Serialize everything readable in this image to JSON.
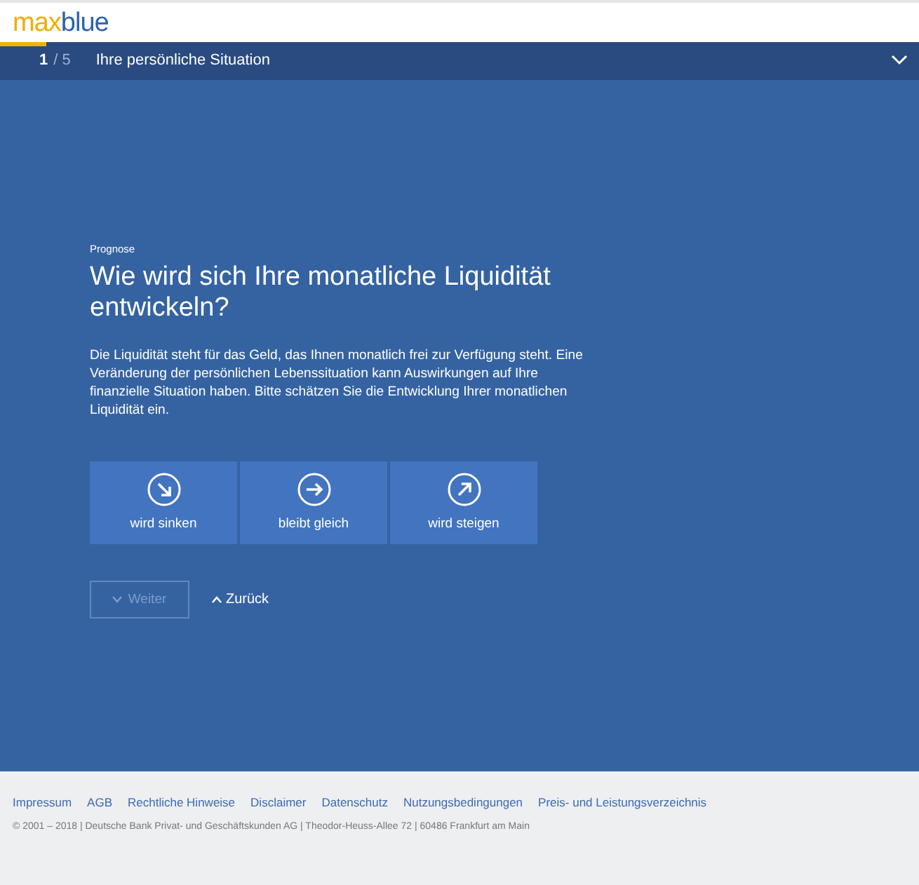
{
  "logo": {
    "part_1": "max",
    "part_2": "blue"
  },
  "steps": {
    "current": "1",
    "total": "/ 5",
    "title": "Ihre persönliche Situation",
    "level": 0.05,
    "expanded": false
  },
  "question": {
    "eyebrow": "Prognose",
    "title": "Wie wird sich Ihre monatliche Liquidität entwickeln?",
    "text": "Die Liquidität steht für das Geld, das Ihnen monatlich frei zur Verfügung steht. Eine Veränderung der persönlichen Lebenssituation kann Auswirkungen auf Ihre finanzielle Situation haben. Bitte schätzen Sie die Entwicklung Ihrer monatlichen Liquidität ein."
  },
  "options": [
    {
      "label": "wird sinken",
      "kind": "down",
      "selected": false
    },
    {
      "label": "bleibt gleich",
      "kind": "right",
      "selected": false
    },
    {
      "label": "wird steigen",
      "kind": "up",
      "selected": false
    }
  ],
  "nav": {
    "next": {
      "label": "Weiter",
      "disabled": true
    },
    "back": {
      "label": "Zurück"
    }
  },
  "footer": {
    "links": [
      "Impressum",
      "AGB",
      "Rechtliche Hinweise",
      "Disclaimer",
      "Datenschutz",
      "Nutzungsbedingungen",
      "Preis- und Leistungsverzeichnis"
    ],
    "copyright": "© 2001 – 2018 | Deutsche Bank Privat- und Geschäftskunden AG | Theodor-Heuss-Allee 72 | 60486 Frankfurt am Main"
  }
}
